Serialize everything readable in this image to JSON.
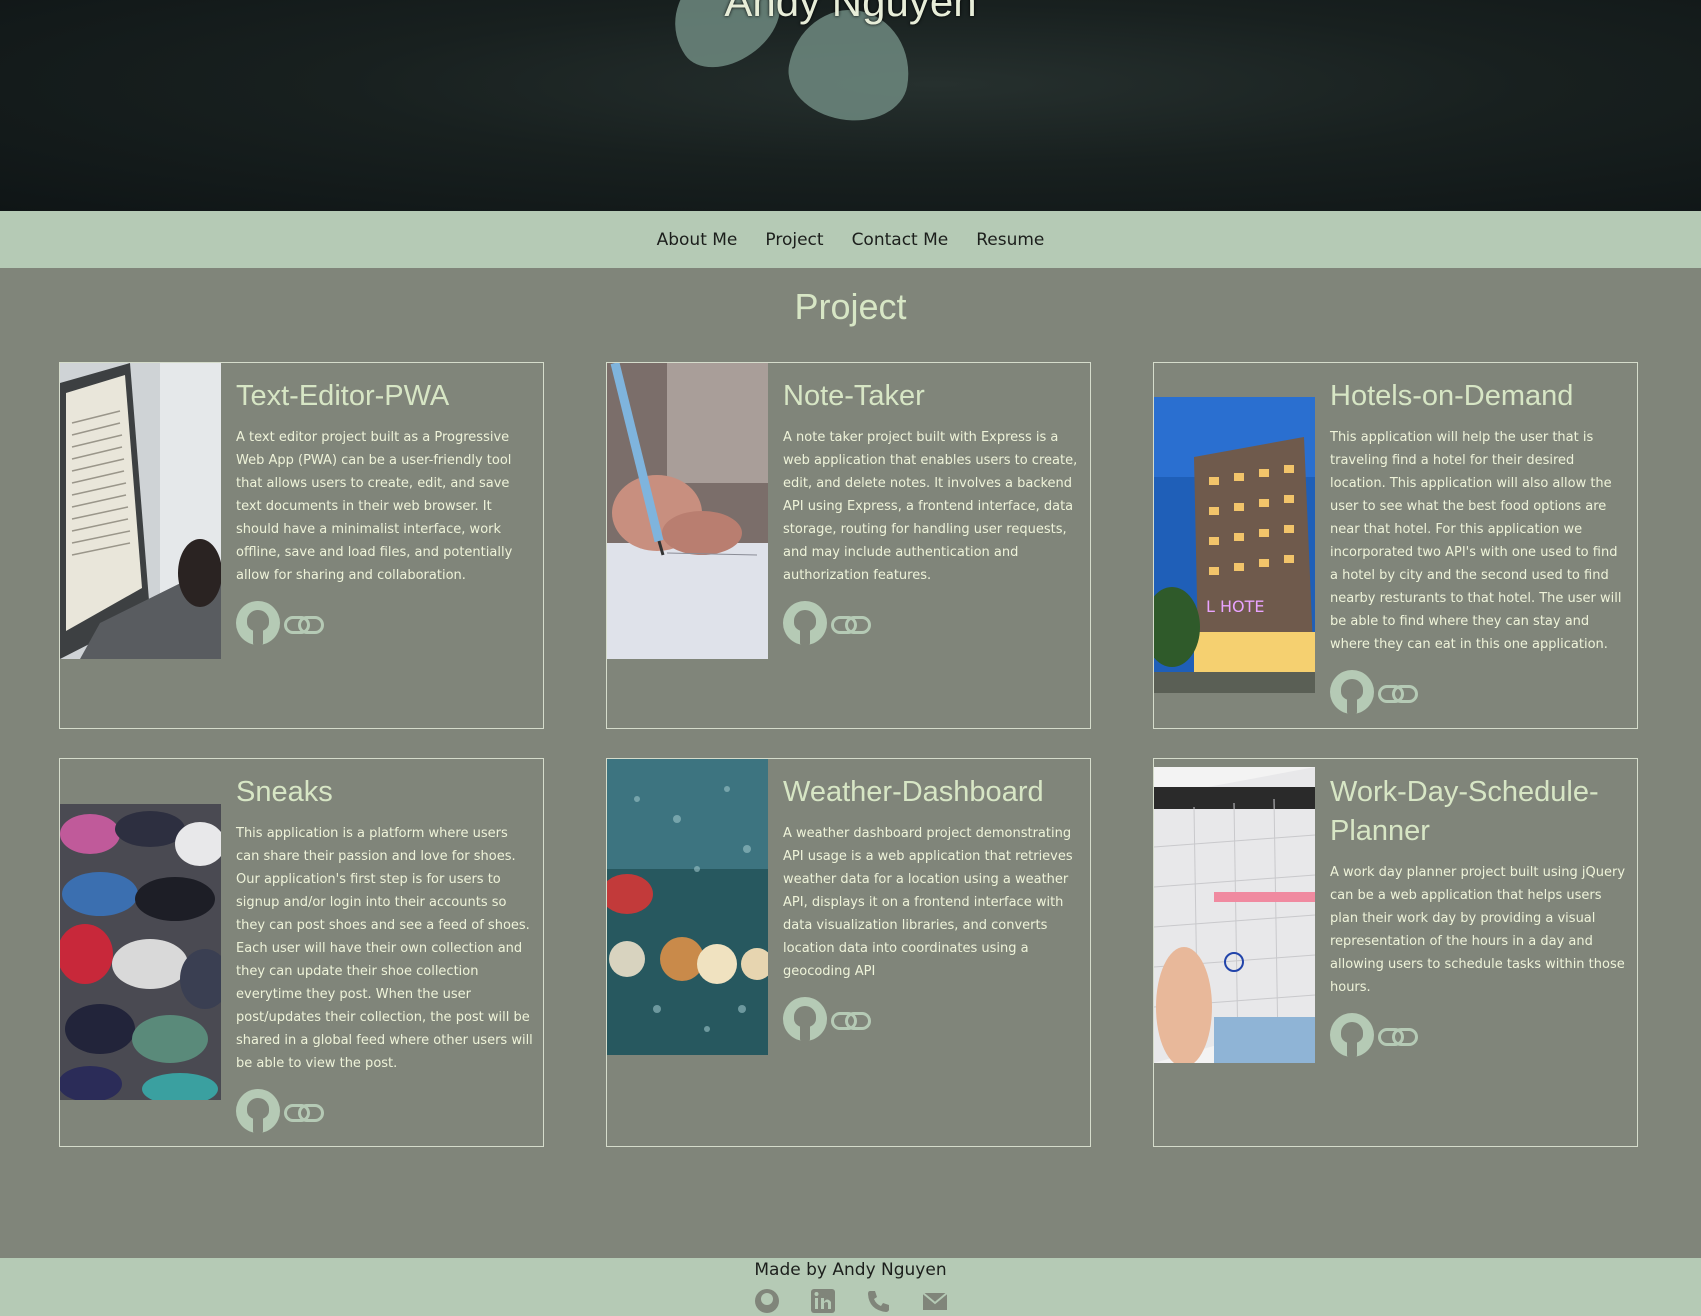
{
  "hero": {
    "name": "Andy Nguyen"
  },
  "nav": {
    "items": [
      "About Me",
      "Project",
      "Contact Me",
      "Resume"
    ]
  },
  "section_title": "Project",
  "projects": [
    {
      "title": "Text-Editor-PWA",
      "description": "A text editor project built as a Progressive Web App (PWA) can be a user-friendly tool that allows users to create, edit, and save text documents in their web browser. It should have a minimalist interface, work offline, save and load files, and potentially allow for sharing and collaboration.",
      "image": "laptop-reading-image",
      "icons": [
        "github-icon",
        "link-icon"
      ]
    },
    {
      "title": "Note-Taker",
      "description": "A note taker project built with Express is a web application that enables users to create, edit, and delete notes. It involves a backend API using Express, a frontend interface, data storage, routing for handling user requests, and may include authentication and authorization features.",
      "image": "hand-writing-image",
      "icons": [
        "github-icon",
        "link-icon"
      ]
    },
    {
      "title": "Hotels-on-Demand",
      "description": "This application will help the user that is traveling find a hotel for their desired location. This application will also allow the user to see what the best food options are near that hotel. For this application we incorporated two API's with one used to find a hotel by city and the second used to find nearby resturants to that hotel. The user will be able to find where they can stay and where they can eat in this one application.",
      "image": "hotel-building-image",
      "image_sign": "L HOTE",
      "icons": [
        "github-icon",
        "link-icon"
      ]
    },
    {
      "title": "Sneaks",
      "description": "This application is a platform where users can share their passion and love for shoes. Our application's first step is for users to signup and/or login into their accounts so they can post shoes and see a feed of shoes. Each user will have their own collection and they can update their shoe collection everytime they post. When the user post/updates their collection, the post will be shared in a global feed where other users will be able to view the post.",
      "image": "sneakers-pile-image",
      "icons": [
        "github-icon",
        "link-icon"
      ]
    },
    {
      "title": "Weather-Dashboard",
      "description": "A weather dashboard project demonstrating API usage is a web application that retrieves weather data for a location using a weather API, displays it on a frontend interface with data visualization libraries, and converts location data into coordinates using a geocoding API",
      "image": "rainy-window-image",
      "icons": [
        "github-icon",
        "link-icon"
      ]
    },
    {
      "title": "Work-Day-Schedule-Planner",
      "description": "A work day planner project built using jQuery can be a web application that helps users plan their work day by providing a visual representation of the hours in a day and allowing users to schedule tasks within those hours.",
      "image": "calendar-tablet-image",
      "icons": [
        "github-icon",
        "link-icon"
      ]
    }
  ],
  "footer": {
    "made_by": "Made by Andy Nguyen",
    "icons": [
      "github-icon",
      "linkedin-icon",
      "phone-icon",
      "email-icon"
    ]
  },
  "colors": {
    "background": "#80857a",
    "nav_bg": "#b5cab5",
    "heading": "#d7e6c5",
    "text": "#eef3d9"
  }
}
